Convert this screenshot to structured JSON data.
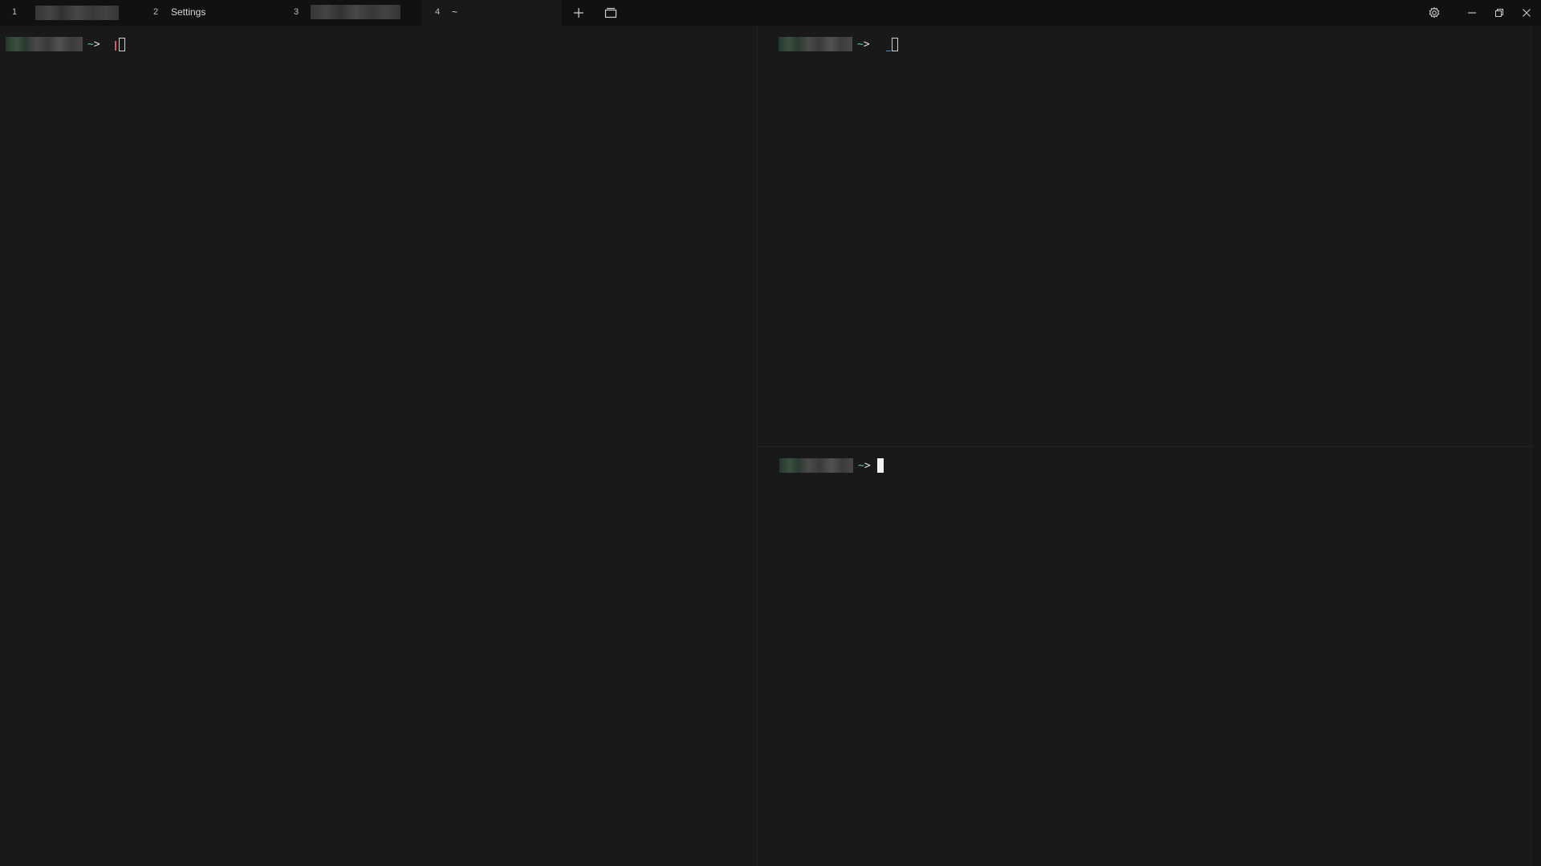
{
  "tabs": [
    {
      "index": "1",
      "title": "",
      "title_redacted": true,
      "active": false
    },
    {
      "index": "2",
      "title": "Settings",
      "title_redacted": false,
      "active": false
    },
    {
      "index": "3",
      "title": "",
      "title_redacted": true,
      "active": false
    },
    {
      "index": "4",
      "title": "~",
      "title_redacted": false,
      "active": true
    }
  ],
  "toolbar": {
    "new_tab_icon": "plus-icon",
    "tab_overview_icon": "window-stack-icon",
    "settings_icon": "gear-icon",
    "minimize_icon": "minimize-icon",
    "restore_icon": "restore-icon",
    "close_icon": "close-icon"
  },
  "panes": {
    "left": {
      "prompt_symbol": "~",
      "prompt_gt": ">"
    },
    "right_top": {
      "prompt_symbol": "~",
      "prompt_gt": ">"
    },
    "right_bottom": {
      "prompt_symbol": "~",
      "prompt_gt": ">"
    }
  },
  "colors": {
    "background": "#191919",
    "titlebar": "#111111",
    "prompt_accent": "#5fd08a",
    "cursor": "#f2f2f2"
  }
}
